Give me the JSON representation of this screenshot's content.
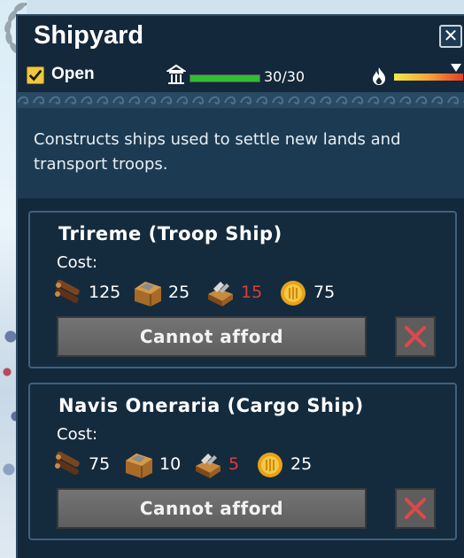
{
  "window": {
    "title": "Shipyard",
    "close_glyph": "✕"
  },
  "status": {
    "open_checked": true,
    "open_label": "Open",
    "health_text": "30/30",
    "health_fraction": 1.0,
    "heat_level": 0.9
  },
  "description": "Constructs ships used to settle new lands and transport troops.",
  "ships": [
    {
      "title": "Trireme (Troop Ship)",
      "cost_label": "Cost:",
      "costs": [
        {
          "icon": "wood-icon",
          "amount": "125",
          "short": false
        },
        {
          "icon": "stone-icon",
          "amount": "25",
          "short": false
        },
        {
          "icon": "tools-icon",
          "amount": "15",
          "short": true
        },
        {
          "icon": "coin-icon",
          "amount": "75",
          "short": false
        }
      ],
      "button_label": "Cannot afford"
    },
    {
      "title": "Navis Oneraria (Cargo Ship)",
      "cost_label": "Cost:",
      "costs": [
        {
          "icon": "wood-icon",
          "amount": "75",
          "short": false
        },
        {
          "icon": "stone-icon",
          "amount": "10",
          "short": false
        },
        {
          "icon": "tools-icon",
          "amount": "5",
          "short": true
        },
        {
          "icon": "coin-icon",
          "amount": "25",
          "short": false
        }
      ],
      "button_label": "Cannot afford"
    }
  ],
  "colors": {
    "panel_bg": "#13283a",
    "shortage_red": "#e23b3b",
    "health_green": "#2fbf2f",
    "checkbox_gold": "#f0c83c"
  }
}
